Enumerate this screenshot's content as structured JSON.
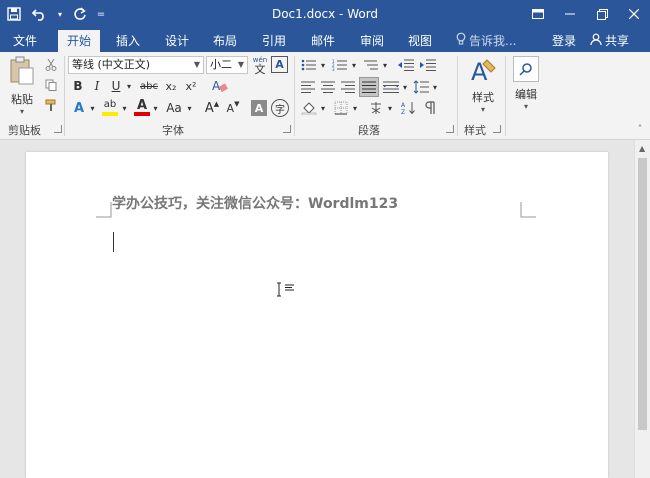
{
  "window": {
    "title": "Doc1.docx - Word"
  },
  "qat": {
    "dropdown": "="
  },
  "tabs": [
    {
      "label": "文件"
    },
    {
      "label": "开始"
    },
    {
      "label": "插入"
    },
    {
      "label": "设计"
    },
    {
      "label": "布局"
    },
    {
      "label": "引用"
    },
    {
      "label": "邮件"
    },
    {
      "label": "审阅"
    },
    {
      "label": "视图"
    }
  ],
  "tell_me": {
    "placeholder": "告诉我..."
  },
  "account": {
    "login": "登录",
    "share": "共享"
  },
  "ribbon": {
    "clipboard": {
      "label": "剪贴板",
      "paste": "粘贴"
    },
    "font": {
      "label": "字体",
      "font_name": "等线 (中文正文)",
      "font_size": "小二",
      "wen": "wén",
      "wen_char": "文",
      "A_box": "A",
      "bold": "B",
      "italic": "I",
      "underline": "U",
      "strike": "abc",
      "sub": "x₂",
      "sup": "x²",
      "text_effect": "A",
      "highlight": "ab",
      "font_color": "A",
      "change_case": "Aa",
      "grow": "A",
      "shrink": "A",
      "shade": "A",
      "circle": "字"
    },
    "paragraph": {
      "label": "段落"
    },
    "styles": {
      "label": "样式",
      "button": "样式"
    },
    "editing": {
      "button": "编辑"
    }
  },
  "document": {
    "heading": "学办公技巧，关注微信公众号：Wordlm123"
  },
  "colors": {
    "accent": "#2b579a",
    "highlight_yellow": "#ffeb00",
    "font_red": "#e00000"
  }
}
